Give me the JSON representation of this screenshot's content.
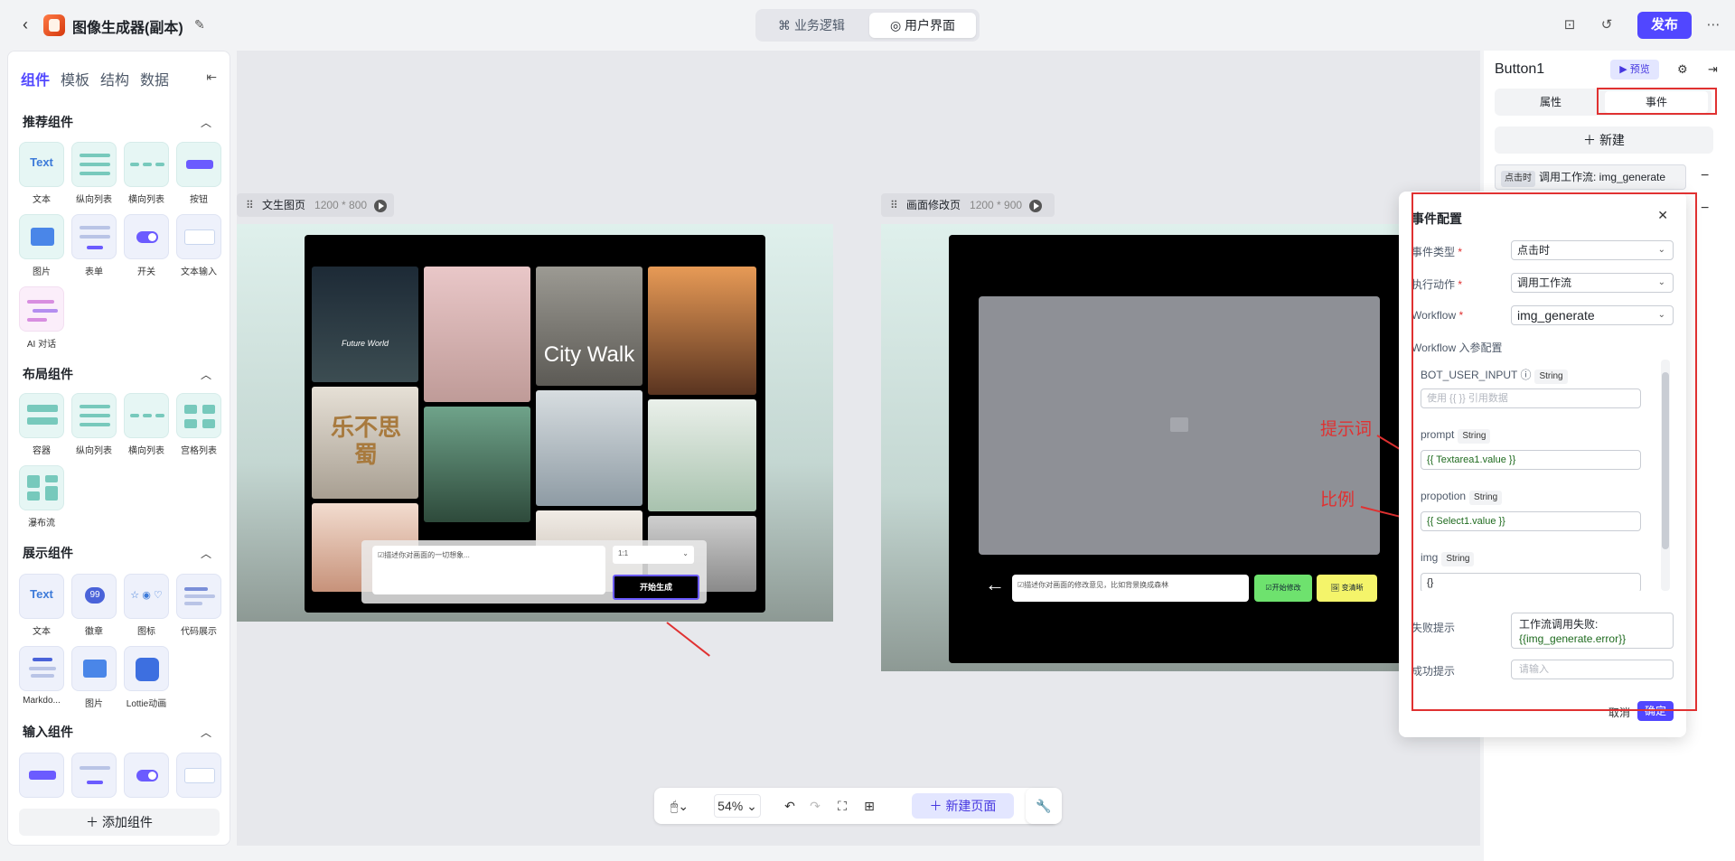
{
  "header": {
    "title": "图像生成器(副本)",
    "tabs": [
      "业务逻辑",
      "用户界面"
    ],
    "publish": "发布"
  },
  "left_panel": {
    "tabs": [
      "组件",
      "模板",
      "结构",
      "数据"
    ],
    "sections": [
      {
        "title": "推荐组件",
        "items": [
          "文本",
          "纵向列表",
          "横向列表",
          "按钮",
          "图片",
          "表单",
          "开关",
          "文本输入",
          "AI 对话"
        ]
      },
      {
        "title": "布局组件",
        "items": [
          "容器",
          "纵向列表",
          "横向列表",
          "宫格列表",
          "瀑布流"
        ]
      },
      {
        "title": "展示组件",
        "items": [
          "文本",
          "徽章",
          "图标",
          "代码展示",
          "Markdo...",
          "图片",
          "Lottie动画"
        ]
      },
      {
        "title": "输入组件",
        "items": []
      }
    ],
    "add_component": "添加组件",
    "tile_text": "Text",
    "badge_text": "99"
  },
  "canvas": {
    "pages": [
      {
        "name": "文生图页",
        "size": "1200 * 800"
      },
      {
        "name": "画面修改页",
        "size": "1200 * 900"
      }
    ],
    "page1": {
      "prompt_placeholder": "☑描述你对画面的一切想象...",
      "ratio": "1:1",
      "generate": "开始生成",
      "img_text_1": "Future World",
      "img_text_2": "City Walk",
      "img_text_3": "乐不思蜀"
    },
    "page2": {
      "input_placeholder": "☑描述你对画面的修改意见，比如背景换成森林",
      "btn_modify": "☑开始修改",
      "btn_hd": "🖼 变清晰"
    },
    "zoom": "54%",
    "new_page": "新建页面"
  },
  "annotations": {
    "prompt_label": "提示词",
    "ratio_label": "比例"
  },
  "right_panel": {
    "component": "Button1",
    "preview": "预览",
    "tabs": [
      "属性",
      "事件"
    ],
    "new": "新建",
    "event_tag": "点击时",
    "event_text": "调用工作流: img_generate"
  },
  "dialog": {
    "title": "事件配置",
    "event_type_label": "事件类型",
    "event_type": "点击时",
    "action_label": "执行动作",
    "action": "调用工作流",
    "workflow_label": "Workflow",
    "workflow": "img_generate",
    "params_label": "Workflow 入参配置",
    "params": [
      {
        "name": "BOT_USER_INPUT",
        "type": "String",
        "value": "",
        "placeholder": "使用 {{ }} 引用数据"
      },
      {
        "name": "prompt",
        "type": "String",
        "value": "{{ Textarea1.value }}"
      },
      {
        "name": "propotion",
        "type": "String",
        "value": "{{ Select1.value }}"
      },
      {
        "name": "img",
        "type": "String",
        "value": "{}"
      }
    ],
    "fail_label": "失败提示",
    "fail_text_prefix": "工作流调用失败:",
    "fail_text_binding": "{{img_generate.error}}",
    "success_label": "成功提示",
    "success_placeholder": "请输入",
    "cancel": "取消",
    "confirm": "确定"
  }
}
